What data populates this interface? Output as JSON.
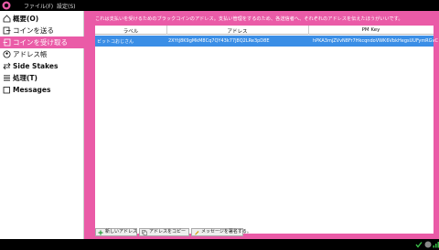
{
  "menu": {
    "file": "ファイル(F)",
    "settings": "設定(S)"
  },
  "sidebar": {
    "items": [
      {
        "label": "概要(O)",
        "icon": "home-icon"
      },
      {
        "label": "コインを送る",
        "icon": "send-icon"
      },
      {
        "label": "コインを受け取る",
        "icon": "receive-icon"
      },
      {
        "label": "アドレス帳",
        "icon": "address-book-icon"
      },
      {
        "label": "Side Stakes",
        "icon": "side-stakes-icon"
      },
      {
        "label": "処理(T)",
        "icon": "transactions-icon"
      },
      {
        "label": "Messages",
        "icon": "messages-icon"
      }
    ],
    "active_index": 2
  },
  "receive": {
    "description": "これは支払いを受けるためのブラックコインのアドレス。支払い管理をするのため、各送信者へ、それぞれのアドレスを伝えたほうがいいです。",
    "columns": [
      "ラベル",
      "アドレス",
      "PM Key"
    ],
    "rows": [
      {
        "label": "ビットコおじさん",
        "address": "2XYtJ8K9gMkM8Cq7QY43k77J8Q2LRe3pD8E",
        "pm_key": "hPKA3mjZVvN8Fr7HkcqndoVWK6VbkHegsUUFymRGvC"
      }
    ]
  },
  "buttons": {
    "new_address": "新しいアドレス",
    "copy_address": "アドレスをコピー",
    "sign_message": "メッセージを署名する。"
  },
  "colors": {
    "accent": "#ea5ba7",
    "selection": "#3a8ee6"
  }
}
